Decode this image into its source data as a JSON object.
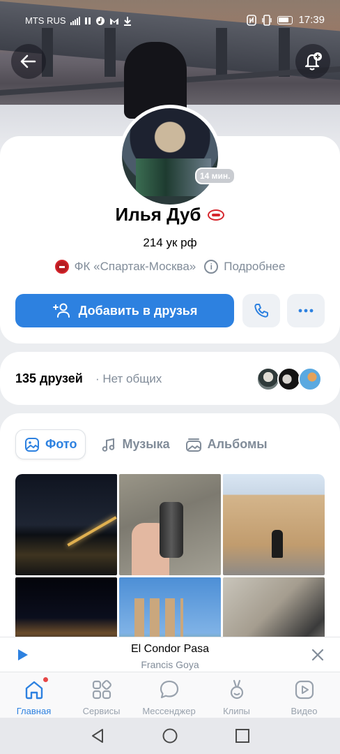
{
  "status_bar": {
    "carrier": "MTS RUS",
    "time": "17:39",
    "indicators": [
      "signal-icon",
      "pause-icon",
      "music-icon",
      "gmail-icon",
      "download-icon",
      "nfc-icon",
      "vibrate-icon",
      "battery-icon"
    ]
  },
  "header": {
    "back_icon": "arrow-left-icon",
    "subscribe_icon": "bell-plus-icon"
  },
  "profile": {
    "name": "Илья Дуб",
    "last_seen": "14 мин.",
    "status": "214 ук рф",
    "club": "ФК «Спартак-Москва»",
    "details_link": "Подробнее",
    "add_friend_label": "Добавить в друзья",
    "call_icon": "phone-icon",
    "more_icon": "more-icon"
  },
  "friends": {
    "count": "135 друзей",
    "mutual": "· Нет общих"
  },
  "media": {
    "tabs": [
      {
        "label": "Фото",
        "icon": "image-icon",
        "active": true
      },
      {
        "label": "Музыка",
        "icon": "music-note-icon",
        "active": false
      },
      {
        "label": "Альбомы",
        "icon": "albums-icon",
        "active": false
      }
    ],
    "photo_count_shown": 6
  },
  "player": {
    "title": "El Condor Pasa",
    "artist": "Francis Goya"
  },
  "tabbar": {
    "items": [
      {
        "label": "Главная",
        "icon": "home-icon",
        "active": true,
        "badge": true
      },
      {
        "label": "Сервисы",
        "icon": "services-icon",
        "active": false
      },
      {
        "label": "Мессенджер",
        "icon": "chat-icon",
        "active": false
      },
      {
        "label": "Клипы",
        "icon": "clips-icon",
        "active": false
      },
      {
        "label": "Видео",
        "icon": "video-icon",
        "active": false
      }
    ]
  },
  "colors": {
    "accent": "#2d81e0",
    "secondary_text": "#818c99",
    "spartak_red": "#d6262d"
  }
}
